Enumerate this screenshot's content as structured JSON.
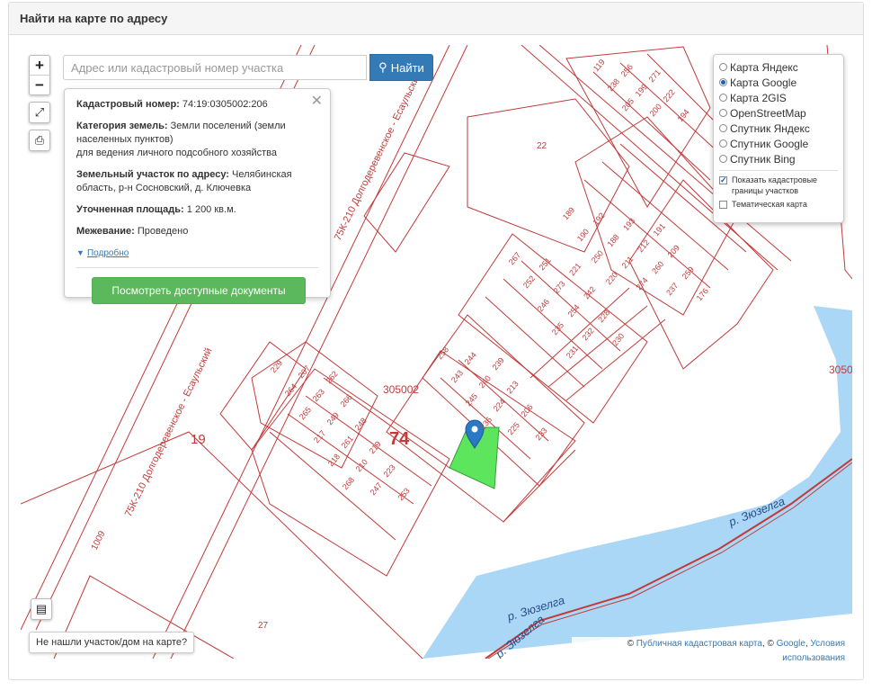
{
  "header": {
    "title": "Найти на карте по адресу"
  },
  "search": {
    "placeholder": "Адрес или кадастровый номер участка",
    "button_label": "Найти"
  },
  "zoom": {
    "in_label": "+",
    "out_label": "−"
  },
  "info": {
    "cad_label": "Кадастровый номер:",
    "cad_value": " 74:19:0305002:206",
    "cat_label": "Категория земель:",
    "cat_value": " Земли поселений (земли населенных пунктов)",
    "cat_use": "для ведения личного подсобного хозяйства",
    "addr_label": "Земельный участок по адресу:",
    "addr_value": " Челябинская область, р-н Сосновский, д. Ключевка",
    "area_label": "Уточненная площадь:",
    "area_value": " 1 200 кв.м.",
    "survey_label": "Межевание:",
    "survey_value": " Проведено",
    "more_label": "Подробно",
    "docs_button": "Посмотреть доступные документы"
  },
  "layers": {
    "options": [
      "Карта Яндекс",
      "Карта Google",
      "Карта 2GIS",
      "OpenStreetMap",
      "Спутник Яндекс",
      "Спутник Google",
      "Спутник Bing"
    ],
    "selected": "Карта Google",
    "checkbox1": "Показать кадастровые границы участков",
    "checkbox1_checked": true,
    "checkbox2": "Тематическая карта",
    "checkbox2_checked": false
  },
  "map": {
    "road_label_1": "75К-210 Долгодеревенское - Есаульский",
    "road_label_2": "75К-210 Долгодеревенское - Есаульский",
    "river_label_1": "р. Зюзелга",
    "river_label_2": "р. Зюзелга",
    "river_label_3": "р. Зюзелга",
    "quarter_label": "305002",
    "quarter_label_right": "3050",
    "region_74": "74",
    "region_19": "19",
    "label_1009": "1009",
    "label_27": "27",
    "label_22": "22",
    "plots_a": [
      "119",
      "256",
      "271",
      "238",
      "199",
      "222",
      "205",
      "200",
      "194"
    ],
    "plots_b": [
      "189",
      "192",
      "193",
      "191",
      "190",
      "188",
      "212",
      "209",
      "250",
      "211",
      "260",
      "259",
      "220",
      "274",
      "237",
      "176"
    ],
    "plots_c": [
      "267",
      "251",
      "221",
      "252",
      "273",
      "242",
      "246",
      "254",
      "228",
      "235",
      "232",
      "230",
      "231"
    ],
    "plots_d": [
      "258",
      "244",
      "239",
      "243",
      "240",
      "213",
      "245",
      "224",
      "206",
      "236",
      "225",
      "233"
    ],
    "plots_e": [
      "229",
      "207",
      "262",
      "264",
      "263",
      "266",
      "265",
      "249",
      "248",
      "217",
      "261",
      "219",
      "218",
      "210",
      "223",
      "268",
      "247",
      "253"
    ],
    "highlight_color": "#5ee55e",
    "line_color": "#c23a3a",
    "water_color": "#a9d7f5"
  },
  "footer": {
    "not_found": "Не нашли участок/дом на карте?",
    "attr_prefix": "© ",
    "attr_pkk": "Публичная кадастровая карта",
    "attr_mid": ", © ",
    "attr_google": "Google",
    "attr_sep": ", ",
    "attr_terms": "Условия использования"
  }
}
